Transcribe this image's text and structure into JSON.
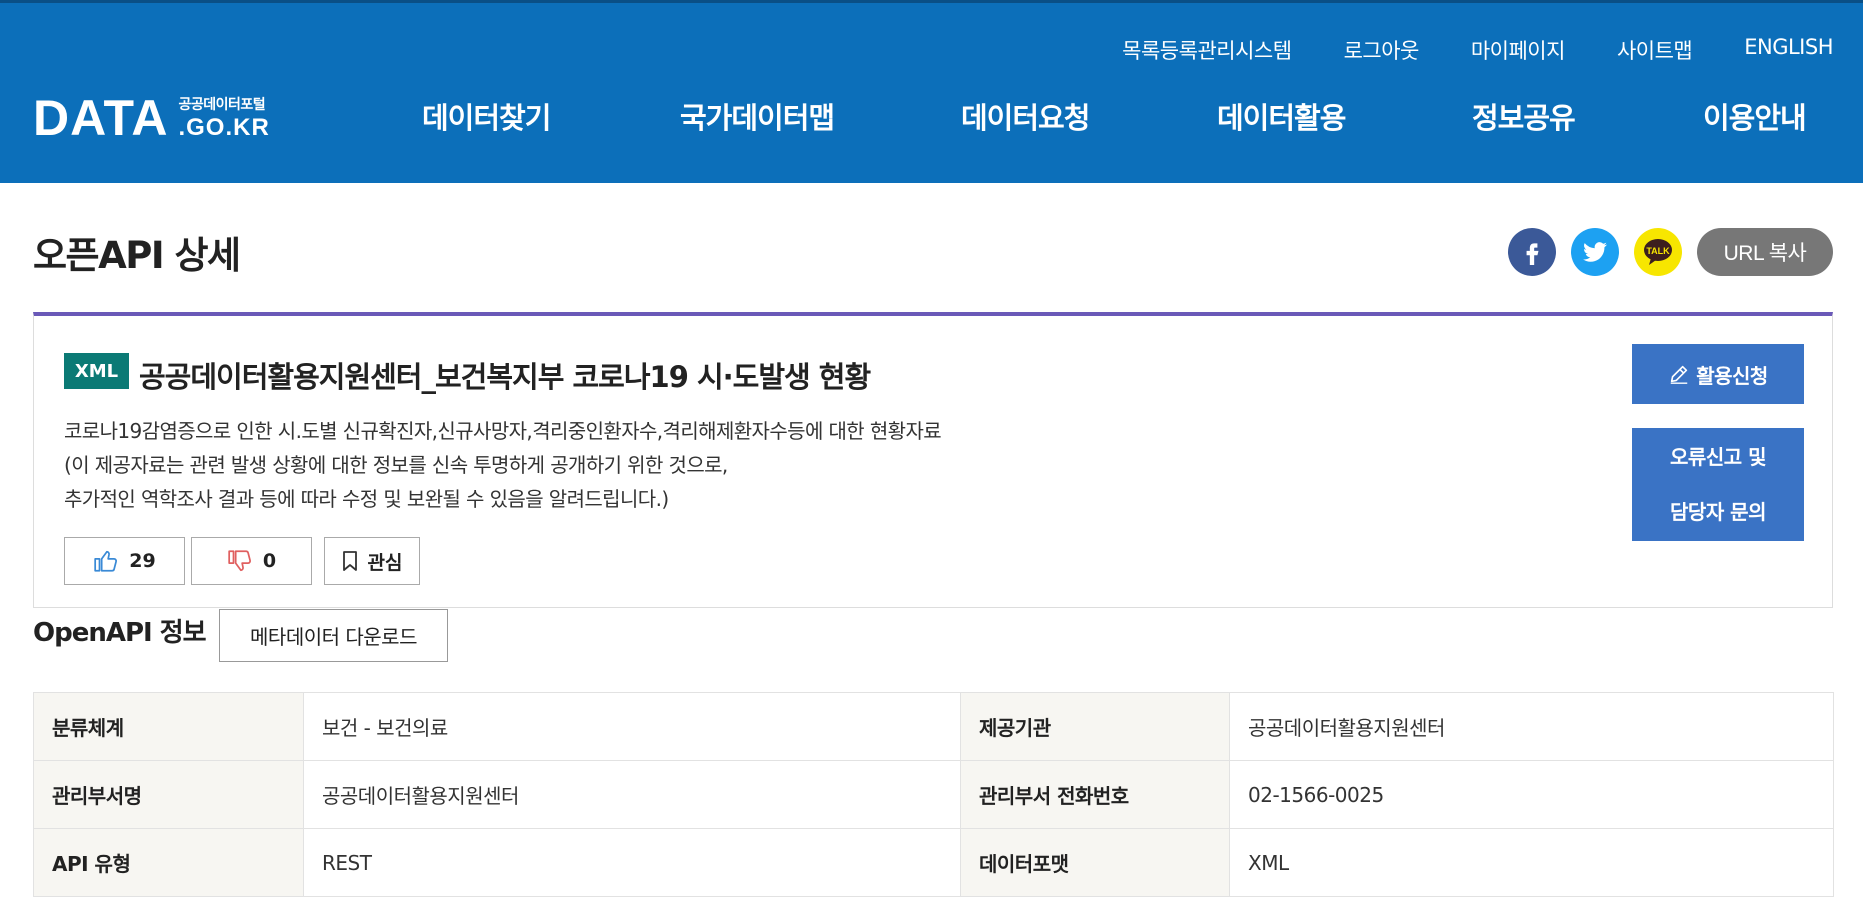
{
  "header": {
    "util_links": [
      "목록등록관리시스템",
      "로그아웃",
      "마이페이지",
      "사이트맵",
      "ENGLISH"
    ],
    "logo": {
      "text": "DATA",
      "korean": "공공데이터포털",
      "domain": ".GO.KR"
    },
    "main_nav": [
      "데이터찾기",
      "국가데이터맵",
      "데이터요청",
      "데이터활용",
      "정보공유",
      "이용안내"
    ]
  },
  "page": {
    "title": "오픈API 상세",
    "share": {
      "facebook_icon": "facebook-icon",
      "twitter_icon": "twitter-icon",
      "kakao_label": "TALK",
      "url_copy": "URL 복사"
    }
  },
  "dataset": {
    "format_badge": "XML",
    "title": "공공데이터활용지원센터_보건복지부 코로나19 시·도발생 현황",
    "description": [
      "코로나19감염증으로 인한 시.도별 신규확진자,신규사망자,격리중인환자수,격리해제환자수등에 대한 현황자료",
      "(이 제공자료는 관련 발생 상황에 대한 정보를 신속 투명하게 공개하기 위한 것으로,",
      "추가적인 역학조사 결과 등에 따라 수정 및 보완될 수 있음을 알려드립니다.)"
    ],
    "likes": "29",
    "dislikes": "0",
    "favorite_label": "관심",
    "apply_button": "활용신청",
    "report_button_line1": "오류신고 및",
    "report_button_line2": "담당자 문의"
  },
  "openapi": {
    "section_title": "OpenAPI 정보",
    "metadata_download": "메타데이터 다운로드",
    "rows": [
      [
        {
          "label": "분류체계",
          "value": "보건 - 보건의료"
        },
        {
          "label": "제공기관",
          "value": "공공데이터활용지원센터"
        }
      ],
      [
        {
          "label": "관리부서명",
          "value": "공공데이터활용지원센터"
        },
        {
          "label": "관리부서 전화번호",
          "value": "02-1566-0025"
        }
      ],
      [
        {
          "label": "API 유형",
          "value": "REST"
        },
        {
          "label": "데이터포맷",
          "value": "XML"
        }
      ]
    ]
  },
  "colors": {
    "header_bg": "#0c6fba",
    "button_blue": "#3a73c5",
    "badge_teal": "#0b7a75",
    "card_accent": "#6a59b8"
  }
}
